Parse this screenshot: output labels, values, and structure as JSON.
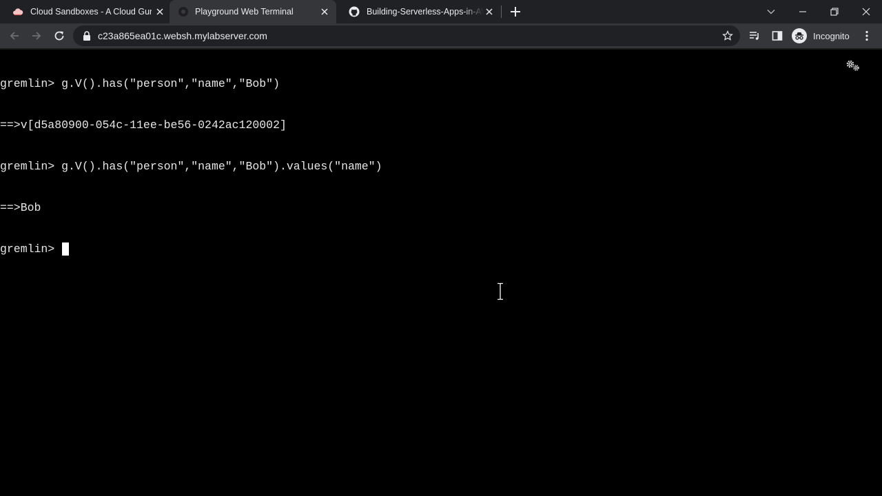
{
  "browser": {
    "tabs": [
      {
        "title": "Cloud Sandboxes - A Cloud Guru",
        "favicon": "cloud-icon",
        "active": false
      },
      {
        "title": "Playground Web Terminal",
        "favicon": "terminal-icon",
        "active": true
      },
      {
        "title": "Building-Serverless-Apps-in-AWS",
        "favicon": "github-icon",
        "active": false
      }
    ],
    "address_bar": {
      "url": "c23a865ea01c.websh.mylabserver.com"
    },
    "profile": {
      "label": "Incognito"
    },
    "colors": {
      "tabstrip": "#202124",
      "toolbar": "#35363a",
      "omnibox": "#202124",
      "text": "#e8eaed"
    }
  },
  "terminal": {
    "background": "#000000",
    "lines": [
      "gremlin> g.V().has(\"person\",\"name\",\"Bob\")",
      "==>v[d5a80900-054c-11ee-be56-0242ac120002]",
      "gremlin> g.V().has(\"person\",\"name\",\"Bob\").values(\"name\")",
      "==>Bob",
      "gremlin> "
    ]
  }
}
